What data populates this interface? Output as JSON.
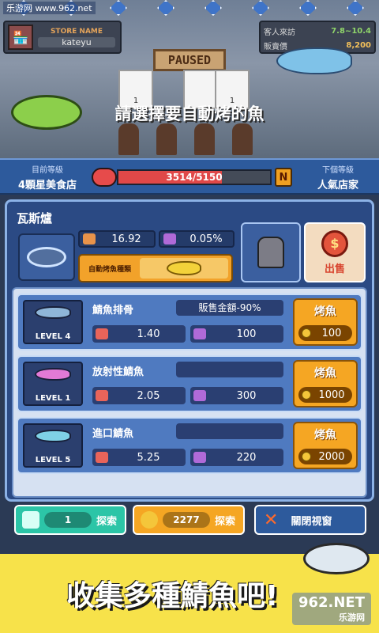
{
  "watermark_top": "乐游网 www.962.net",
  "scene": {
    "store_label": "STORE NAME",
    "store_name": "kateyu",
    "stats": [
      {
        "key": "客人來訪",
        "value": "7.8~10.4"
      },
      {
        "key": "販賣價",
        "value": "8,200"
      }
    ],
    "paused_sign": "PAUSED",
    "card_values": [
      "1",
      "1"
    ],
    "prompt": "請選擇要自動烤的魚"
  },
  "level": {
    "current_key": "目前等級",
    "current_value": "4顆星美食店",
    "next_key": "下個等級",
    "next_value": "人氣店家",
    "progress_text": "3514/5150",
    "progress_fraction": 0.682,
    "badge": "N"
  },
  "grill": {
    "title": "瓦斯爐",
    "stat1": "16.92",
    "stat2": "0.05%",
    "auto_label": "自動烤魚種類",
    "sell_label": "出售"
  },
  "fish_rows": [
    {
      "name": "鯖魚排骨",
      "level": "LEVEL 4",
      "note": "販售金額-90%",
      "stat1": "1.40",
      "stat2": "100",
      "button": "烤魚",
      "price": "100",
      "color": "#8fb6d8"
    },
    {
      "name": "放射性鯖魚",
      "level": "LEVEL 1",
      "note": "",
      "stat1": "2.05",
      "stat2": "300",
      "button": "烤魚",
      "price": "1000",
      "color": "#e27ad6"
    },
    {
      "name": "進口鯖魚",
      "level": "LEVEL 5",
      "note": "",
      "stat1": "5.25",
      "stat2": "220",
      "button": "烤魚",
      "price": "2000",
      "color": "#7fd1e6"
    }
  ],
  "bottom": {
    "gem_count": "1",
    "gem_label": "探索",
    "coin_count": "2277",
    "coin_label": "探索",
    "close_label": "關閉視窗"
  },
  "footer": {
    "title": "收集多種鯖魚吧!",
    "watermark": "962.NET",
    "watermark_sub": "乐游网"
  },
  "colors": {
    "primary_blue": "#2d5a9c",
    "accent_orange": "#f5a623",
    "progress_red": "#e04848",
    "teal": "#2cc5a7",
    "footer_yellow": "#f7e24a"
  }
}
